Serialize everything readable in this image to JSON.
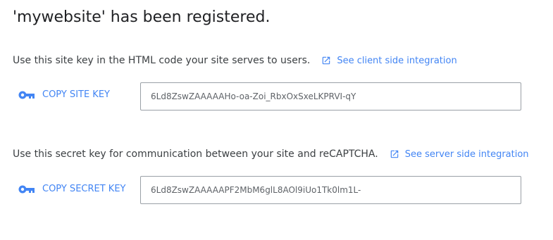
{
  "page_title": "'mywebsite' has been registered.",
  "colors": {
    "link": "#4285f4",
    "text": "#202124",
    "secondary_text": "#5f6368",
    "border": "#9aa0a6"
  },
  "site_key": {
    "description": "Use this site key in the HTML code your site serves to users.",
    "integration_link": "See client side integration",
    "integration_icon": "open-in-new-icon",
    "copy_label": "COPY SITE KEY",
    "copy_icon": "key-icon",
    "value": "6Ld8ZswZAAAAAHo-oa-Zoi_RbxOxSxeLKPRVI-qY"
  },
  "secret_key": {
    "description": "Use this secret key for communication between your site and reCAPTCHA.",
    "integration_link": "See server side integration",
    "integration_icon": "open-in-new-icon",
    "copy_label": "COPY SECRET KEY",
    "copy_icon": "key-icon",
    "value": "6Ld8ZswZAAAAAPF2MbM6glL8AOl9iUo1Tk0lm1L-"
  }
}
